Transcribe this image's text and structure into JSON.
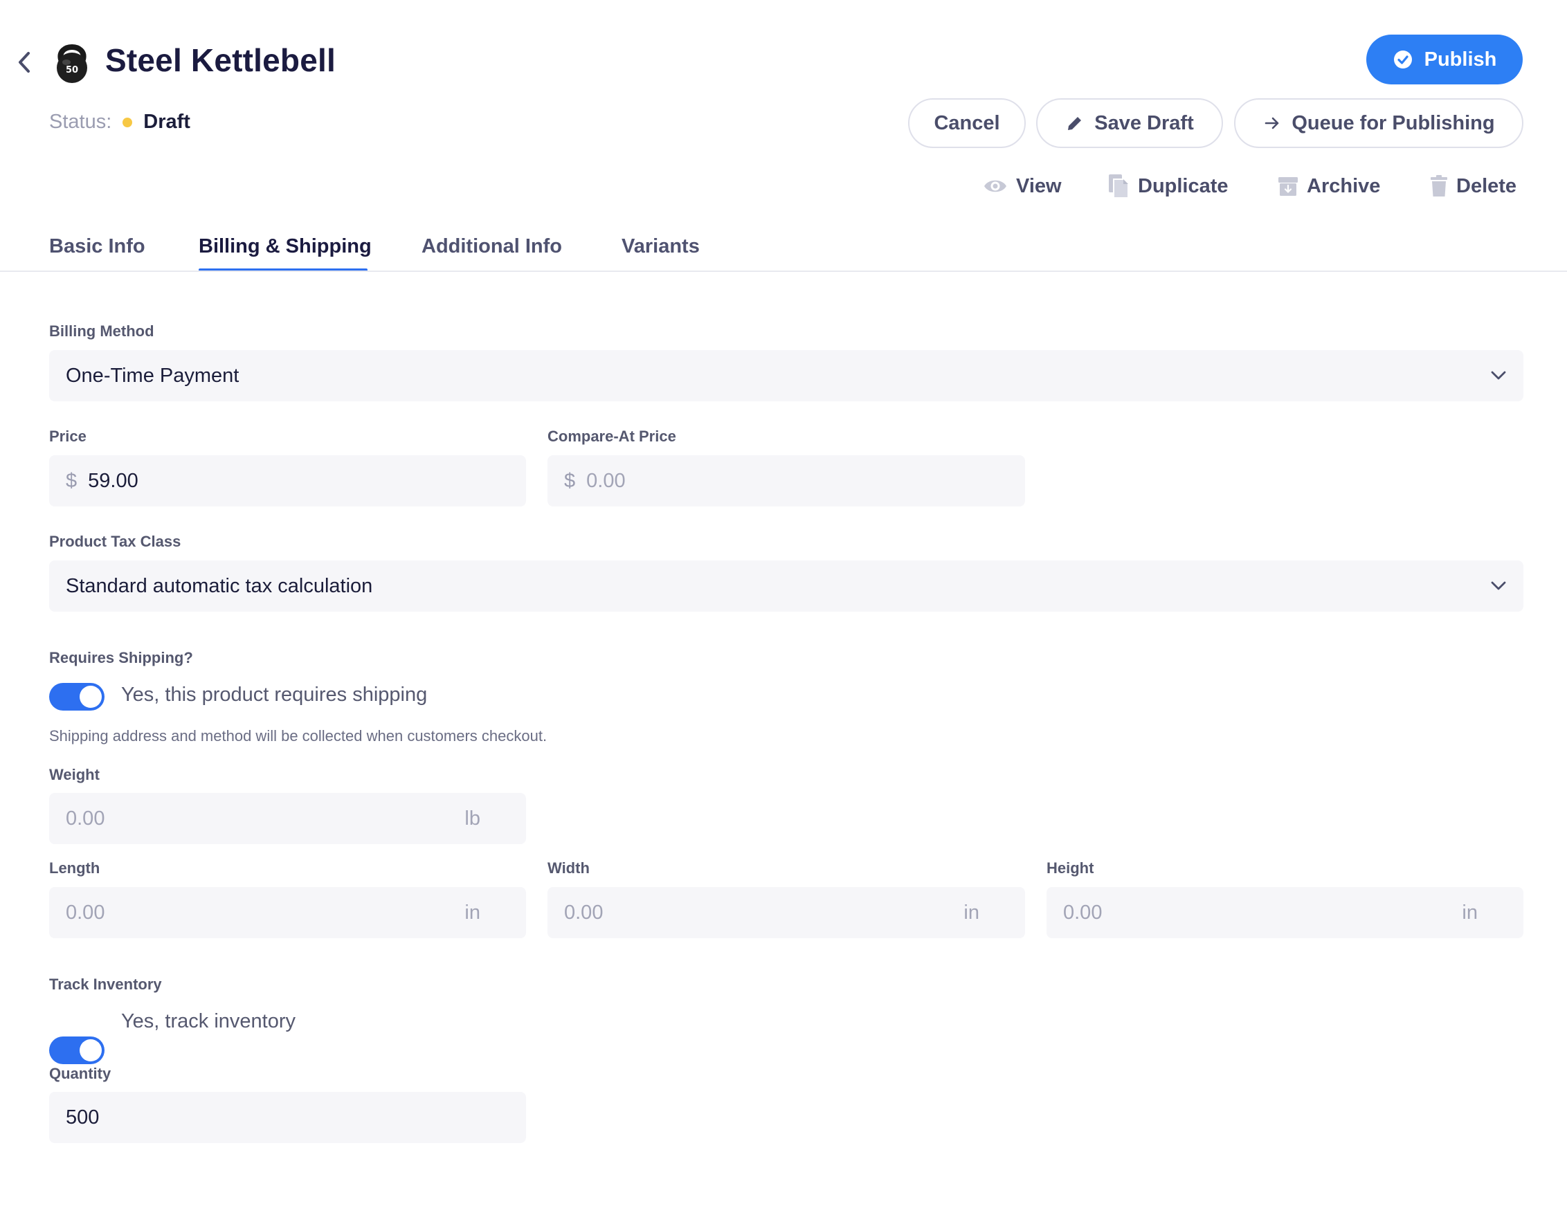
{
  "header": {
    "title": "Steel Kettlebell",
    "icon_badge": "50",
    "status_label": "Status:",
    "status_value": "Draft",
    "status_color": "#f7c844"
  },
  "actions": {
    "publish": "Publish",
    "cancel": "Cancel",
    "save_draft": "Save Draft",
    "queue": "Queue for Publishing",
    "view": "View",
    "duplicate": "Duplicate",
    "archive": "Archive",
    "delete": "Delete"
  },
  "tabs": [
    {
      "label": "Basic Info",
      "active": false
    },
    {
      "label": "Billing & Shipping",
      "active": true
    },
    {
      "label": "Additional Info",
      "active": false
    },
    {
      "label": "Variants",
      "active": false
    }
  ],
  "form": {
    "billing_method": {
      "label": "Billing Method",
      "value": "One-Time Payment"
    },
    "price": {
      "label": "Price",
      "currency": "$",
      "value": "59.00"
    },
    "compare_at_price": {
      "label": "Compare-At Price",
      "currency": "$",
      "placeholder": "0.00"
    },
    "tax_class": {
      "label": "Product Tax Class",
      "value": "Standard automatic tax calculation"
    },
    "requires_shipping": {
      "label": "Requires Shipping?",
      "toggle_text": "Yes, this product requires shipping",
      "help": "Shipping address and method will be collected when customers checkout.",
      "enabled": true
    },
    "weight": {
      "label": "Weight",
      "placeholder": "0.00",
      "unit": "lb"
    },
    "length": {
      "label": "Length",
      "placeholder": "0.00",
      "unit": "in"
    },
    "width": {
      "label": "Width",
      "placeholder": "0.00",
      "unit": "in"
    },
    "height": {
      "label": "Height",
      "placeholder": "0.00",
      "unit": "in"
    },
    "track_inventory": {
      "label": "Track Inventory",
      "toggle_text": "Yes, track inventory",
      "enabled": true
    },
    "quantity": {
      "label": "Quantity",
      "value": "500"
    }
  },
  "colors": {
    "primary": "#2d7ff4",
    "toggle_on": "#2d6ff0",
    "field_bg": "#f6f6f9"
  }
}
